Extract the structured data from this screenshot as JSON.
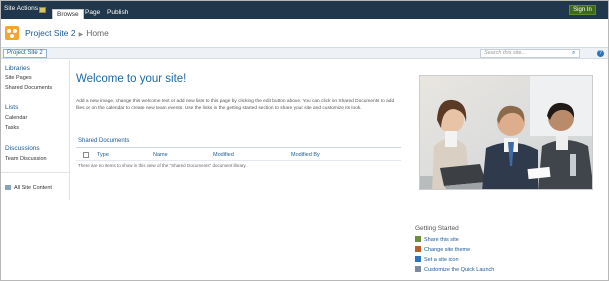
{
  "ribbon": {
    "site_actions": "Site Actions",
    "tabs": [
      "Browse",
      "Page",
      "Publish"
    ],
    "sign_in": "Sign In"
  },
  "title": {
    "site": "Project Site 2",
    "page": "Home"
  },
  "topnav": {
    "current": "Project Site 2",
    "search_placeholder": "Search this site..."
  },
  "leftnav": {
    "libraries": {
      "heading": "Libraries",
      "items": [
        "Site Pages",
        "Shared Documents"
      ]
    },
    "lists": {
      "heading": "Lists",
      "items": [
        "Calendar",
        "Tasks"
      ]
    },
    "discussions": {
      "heading": "Discussions",
      "items": [
        "Team Discussion"
      ]
    },
    "all_content": "All Site Content"
  },
  "main": {
    "welcome": "Welcome to your site!",
    "intro": "Add a new image, change this welcome text or add new lists to this page by clicking the edit button above. You can click on Shared Documents to add files or on the calendar to create new team events. Use the links in the getting started section to share your site and customize its look.",
    "doclib": {
      "title": "Shared Documents",
      "columns": [
        "Type",
        "Name",
        "Modified",
        "Modified By"
      ],
      "empty": "There are no items to show in this view of the \"Shared Documents\" document library."
    }
  },
  "getting_started": {
    "title": "Getting Started",
    "items": [
      "Share this site",
      "Change site theme",
      "Set a site icon",
      "Customize the Quick Launch"
    ]
  },
  "colors": {
    "ribbon": "#21374c",
    "link": "#1d5a97",
    "heading": "#1d6aa8",
    "sign_in": "#3d6a16",
    "logo": "#f2a530"
  }
}
